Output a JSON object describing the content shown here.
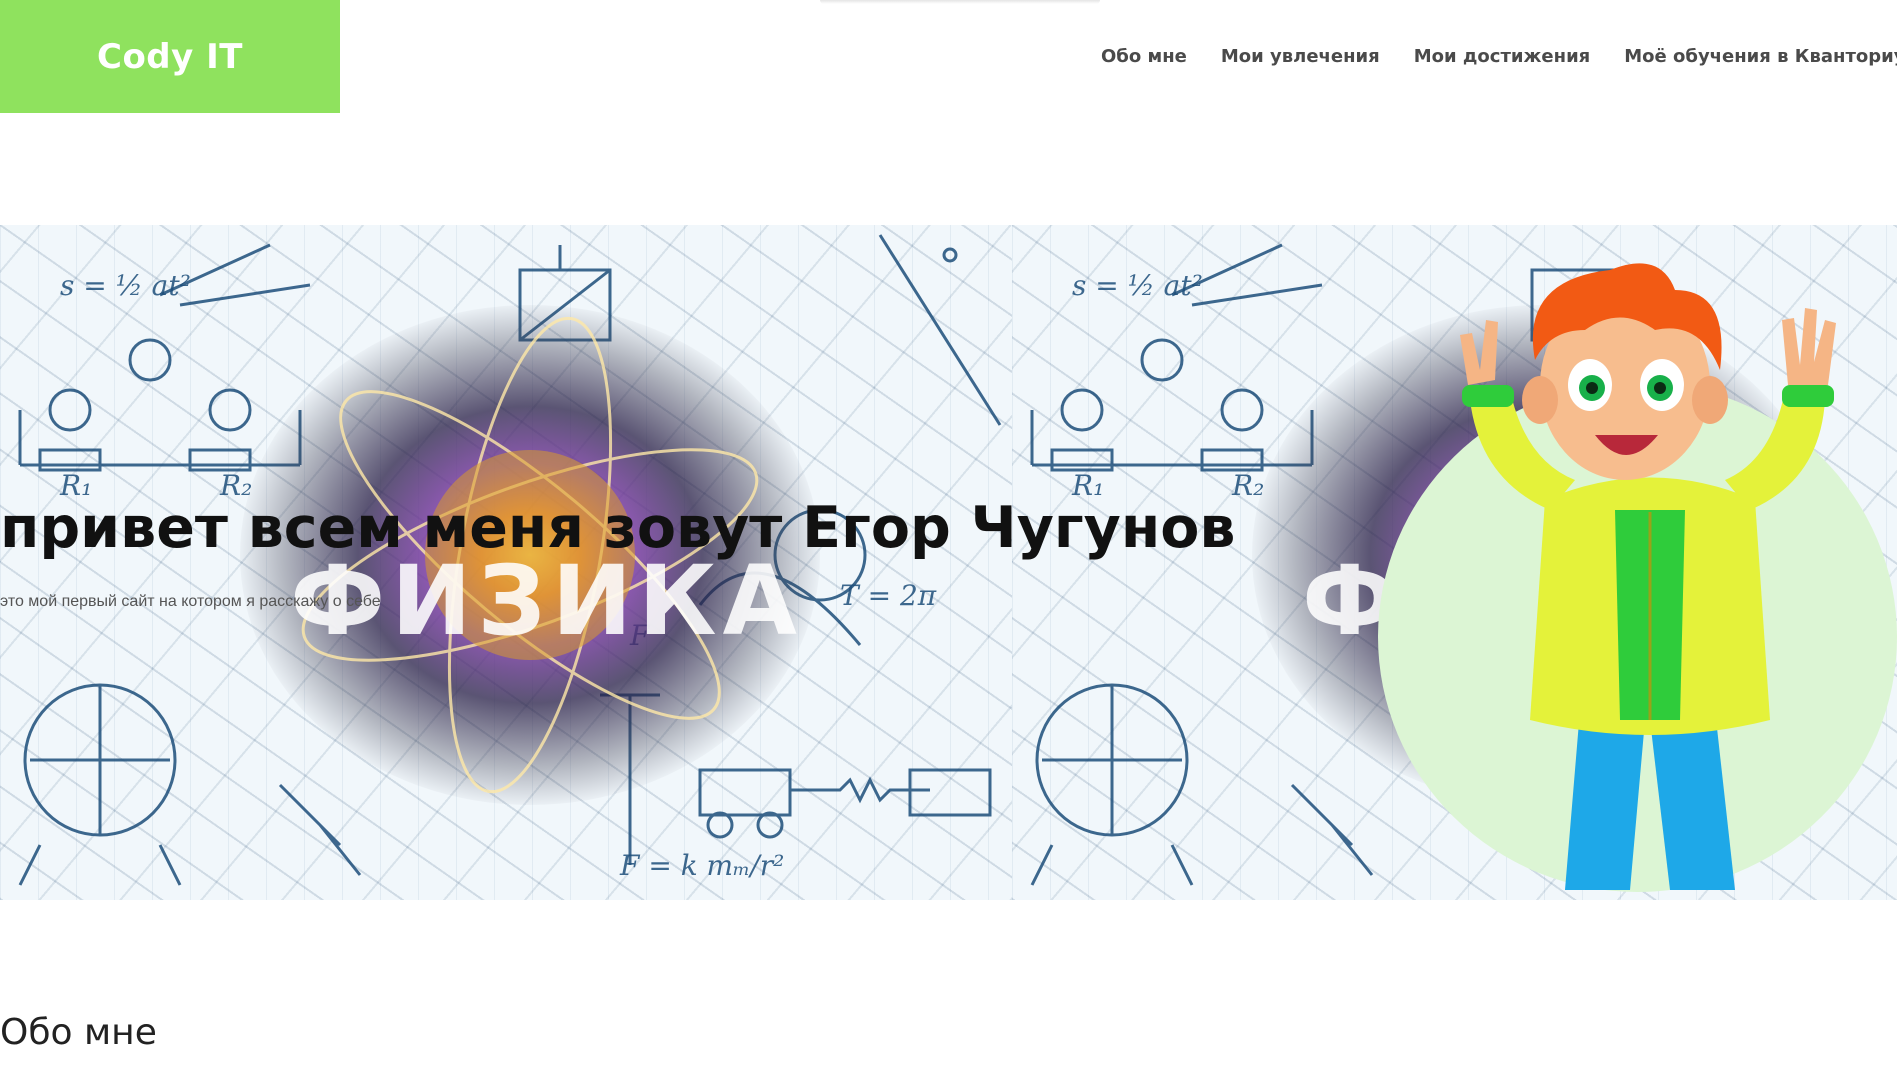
{
  "header": {
    "logo": "Cody IT",
    "nav": [
      {
        "label": "Обо мне"
      },
      {
        "label": "Мои увлечения"
      },
      {
        "label": "Мои достижения"
      },
      {
        "label": "Моё обучения в Кванториуме"
      }
    ]
  },
  "hero": {
    "title": "привет всем меня зовут Егор Чугунов",
    "subtitle": "это мой первый сайт на котором я расскажу о себе",
    "background_word": "ФИЗИКА"
  },
  "section": {
    "title": "Обо мне"
  },
  "colors": {
    "logo_bg": "#8fe25e",
    "nav_text": "#4a4a4a",
    "portrait_bg": "#dcf5d4"
  }
}
